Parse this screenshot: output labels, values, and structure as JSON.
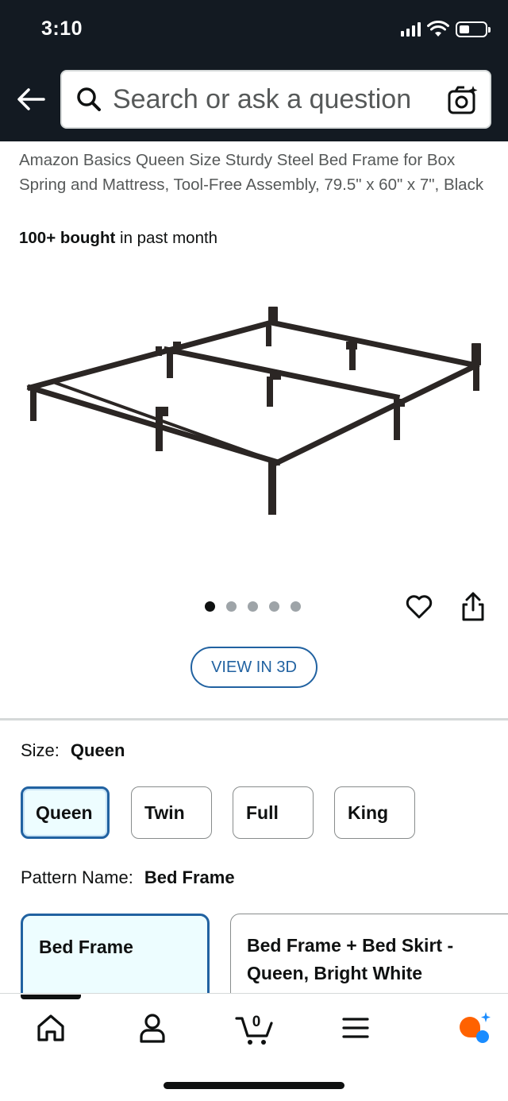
{
  "status_bar": {
    "time": "3:10"
  },
  "search": {
    "placeholder": "Search or ask a question"
  },
  "product": {
    "title": "Amazon Basics Queen Size Sturdy Steel Bed Frame for Box Spring and Mattress, Tool-Free Assembly, 79.5\" x 60\" x 7\", Black",
    "bought_bold": "100+ bought",
    "bought_rest": " in past month",
    "image_count": 5,
    "active_image": 0,
    "view_3d_label": "VIEW IN 3D"
  },
  "size": {
    "label": "Size:",
    "selected": "Queen",
    "options": [
      "Queen",
      "Twin",
      "Full",
      "King"
    ]
  },
  "pattern": {
    "label": "Pattern Name:",
    "selected": "Bed Frame",
    "options": [
      "Bed Frame",
      "Bed Frame + Bed Skirt - Queen, Bright White"
    ]
  },
  "cart": {
    "count": "0"
  },
  "colors": {
    "accent": "#2162a1",
    "topbar": "#131a22",
    "selected_bg": "#edfdff"
  },
  "icons": [
    "back-arrow-icon",
    "search-icon",
    "camera-icon",
    "heart-icon",
    "share-icon",
    "home-icon",
    "account-icon",
    "cart-icon",
    "menu-icon",
    "rufus-icon"
  ]
}
